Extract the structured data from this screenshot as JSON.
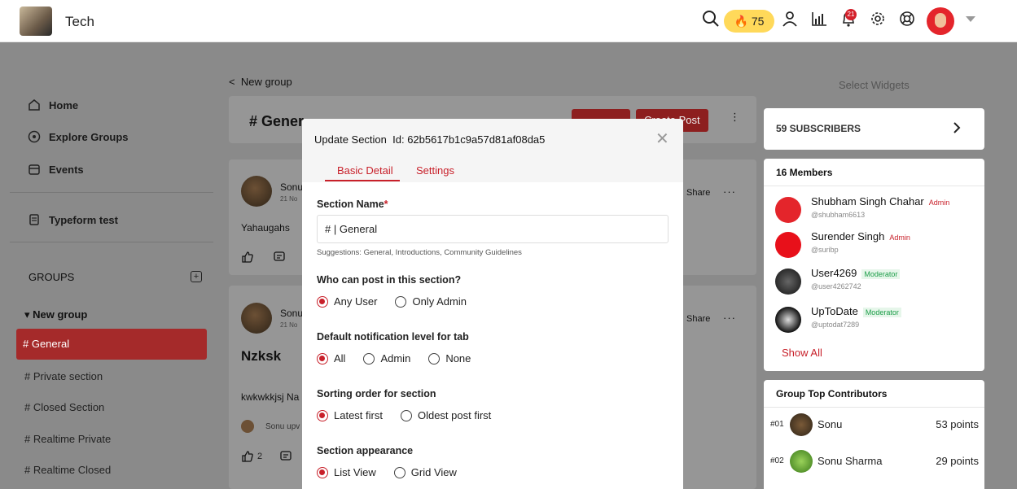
{
  "topbar": {
    "brand": "Tech",
    "streak": "🔥 75",
    "notification_count": "21"
  },
  "sidebar": {
    "items": [
      {
        "label": "Home",
        "icon": "home-icon"
      },
      {
        "label": "Explore Groups",
        "icon": "compass-icon"
      },
      {
        "label": "Events",
        "icon": "calendar-icon"
      },
      {
        "label": "Typeform test",
        "icon": "form-icon"
      }
    ],
    "groups_label": "GROUPS",
    "group_name": "New group",
    "channels": [
      "General",
      "Private section",
      "Closed Section",
      "Realtime Private",
      "Realtime Closed"
    ]
  },
  "feed": {
    "breadcrumb": "New group",
    "title": "# Gener",
    "create_post": "Create Post",
    "posts": [
      {
        "name": "Sonu",
        "date": "21 No",
        "body": "Yahaugahs",
        "share": "Share"
      },
      {
        "name": "Sonu",
        "date": "21 No",
        "title": "Nzksk",
        "body": "kwkwkkjsj Na",
        "upvote": "Sonu upv",
        "likes": "2",
        "share": "Share"
      }
    ]
  },
  "right": {
    "widget_label": "Select Widgets",
    "subscribers": "59 SUBSCRIBERS",
    "members_title": "16 Members",
    "members": [
      {
        "name": "Shubham Singh Chahar",
        "role": "Admin",
        "handle": "@shubham6613"
      },
      {
        "name": "Surender Singh",
        "role": "Admin",
        "handle": "@suribp"
      },
      {
        "name": "User4269",
        "role": "Moderator",
        "handle": "@user4262742"
      },
      {
        "name": "UpToDate",
        "role": "Moderator",
        "handle": "@uptodat7289"
      }
    ],
    "show_all": "Show All",
    "contributors_title": "Group Top Contributors",
    "contributors": [
      {
        "rank": "#01",
        "name": "Sonu",
        "points": "53 points"
      },
      {
        "rank": "#02",
        "name": "Sonu Sharma",
        "points": "29 points"
      }
    ]
  },
  "modal": {
    "title": "Update Section",
    "id_text": "Id: 62b5617b1c9a57d81af08da5",
    "tabs": [
      "Basic Detail",
      "Settings"
    ],
    "section_name_label": "Section Name",
    "section_name_value": "#  |  General",
    "suggestions": "Suggestions: General, Introductions, Community Guidelines",
    "who_post_label": "Who can post in this section?",
    "who_post_options": [
      "Any User",
      "Only Admin"
    ],
    "notif_label": "Default notification level for tab",
    "notif_options": [
      "All",
      "Admin",
      "None"
    ],
    "sort_label": "Sorting order for section",
    "sort_options": [
      "Latest first",
      "Oldest post first"
    ],
    "appearance_label": "Section appearance",
    "appearance_options": [
      "List View",
      "Grid View"
    ]
  }
}
